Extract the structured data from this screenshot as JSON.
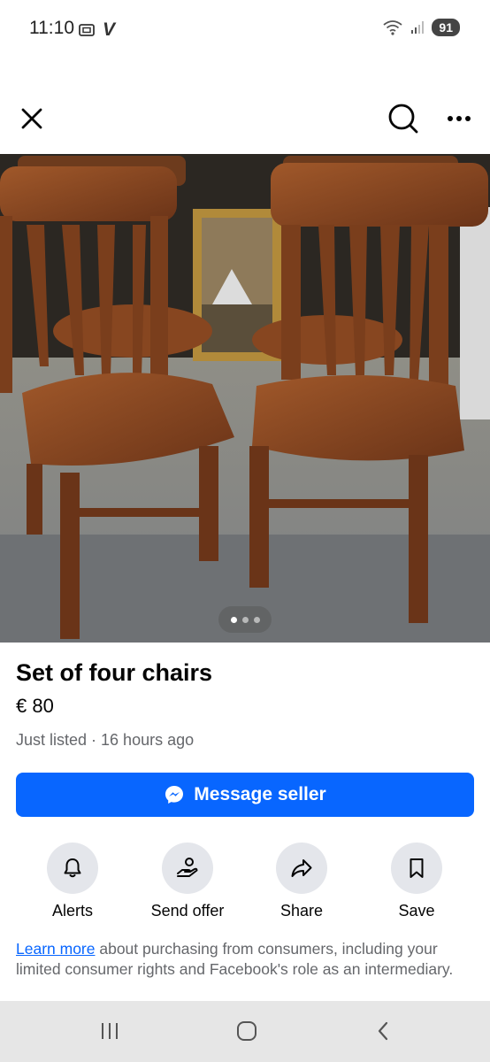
{
  "status_bar": {
    "time": "11:10",
    "carrier_mark": "V",
    "battery": "91"
  },
  "top_bar": {
    "close_icon": "close-icon",
    "search_icon": "search-icon",
    "more_icon": "more-icon"
  },
  "listing": {
    "title": "Set of four chairs",
    "price": "€ 80",
    "listed": "Just listed · 16 hours ago",
    "photo_count": 3,
    "active_photo": 1
  },
  "message_button": {
    "label": "Message seller",
    "icon": "messenger-icon"
  },
  "actions": [
    {
      "label": "Alerts",
      "icon": "bell-icon"
    },
    {
      "label": "Send offer",
      "icon": "offer-hand-icon"
    },
    {
      "label": "Share",
      "icon": "share-arrow-icon"
    },
    {
      "label": "Save",
      "icon": "bookmark-icon"
    }
  ],
  "learn_more": {
    "link": "Learn more",
    "text": " about purchasing from consumers, including your limited consumer rights and Facebook's role as an intermediary."
  },
  "colors": {
    "accent": "#0866ff",
    "secondary_text": "#65676b",
    "action_circle": "#e4e6eb"
  }
}
